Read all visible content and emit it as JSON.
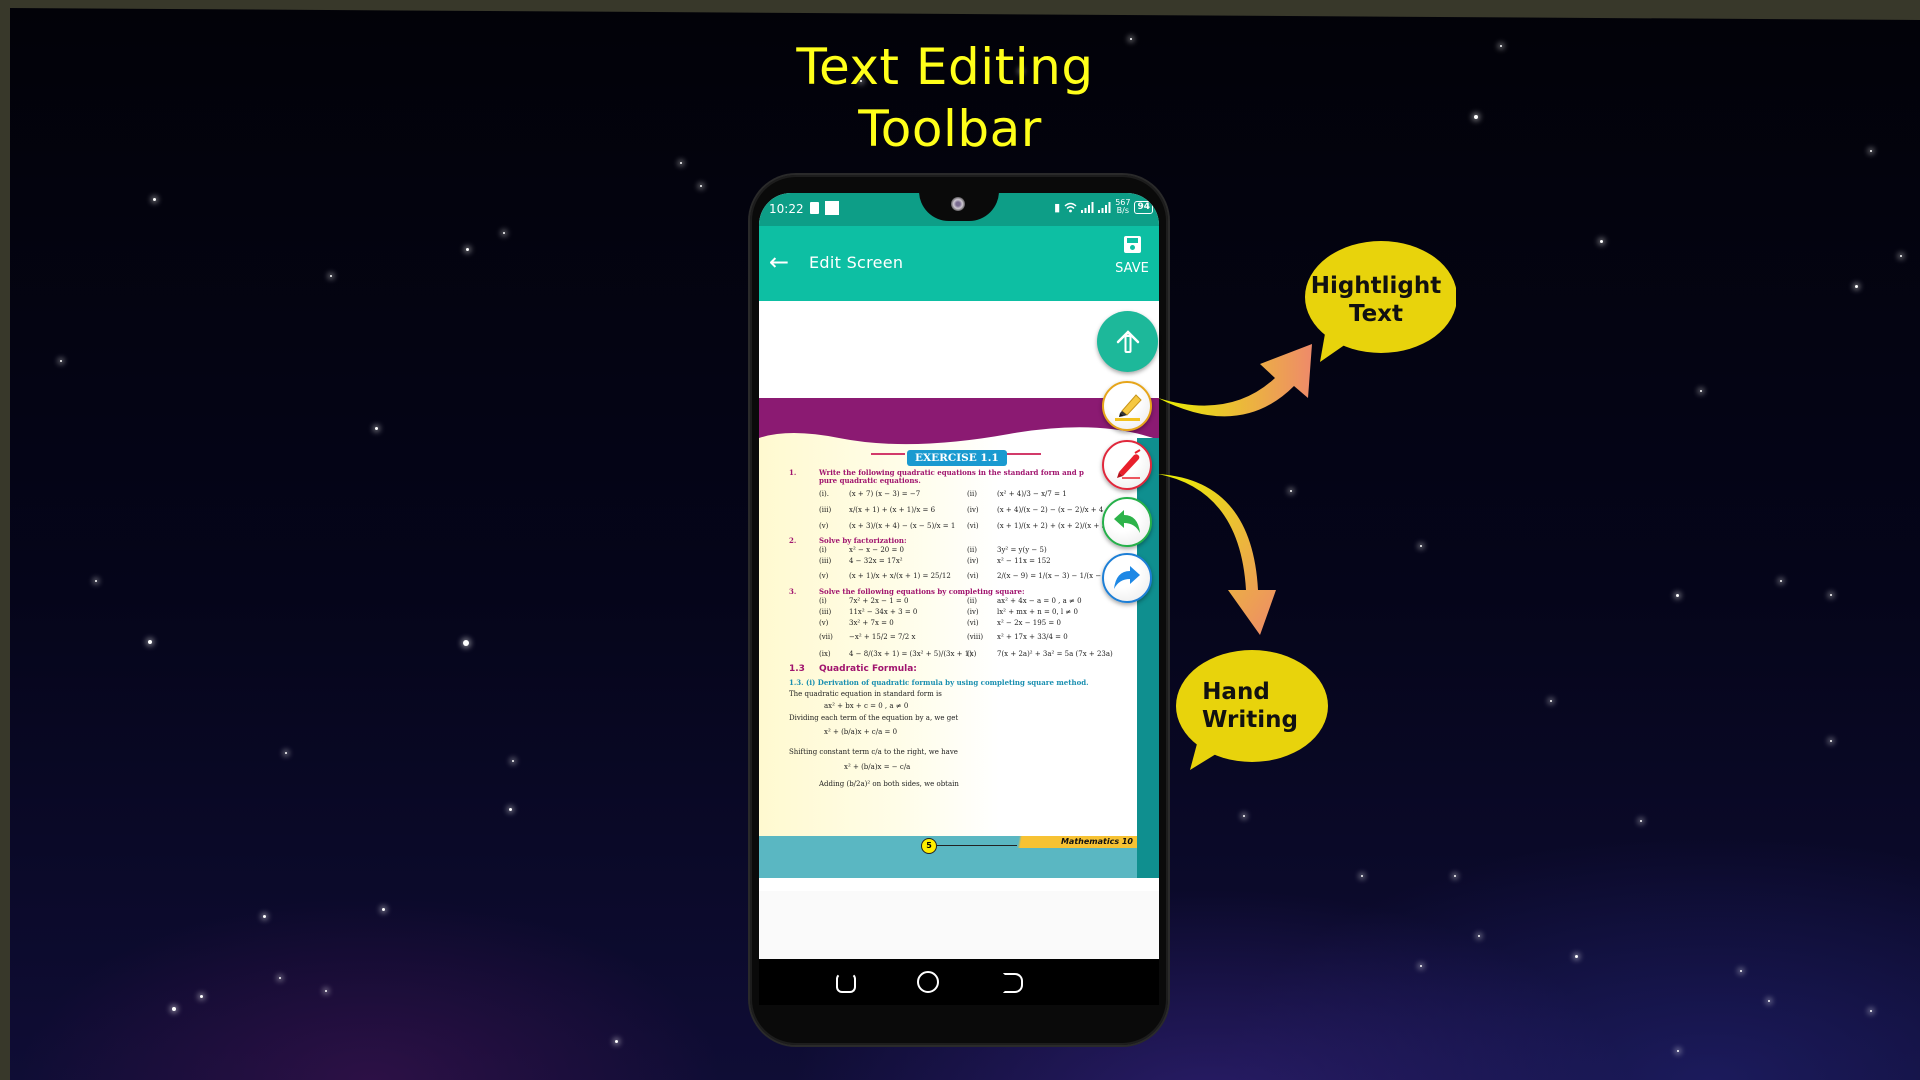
{
  "banner": {
    "title_line1": "Text Editing",
    "title_line2": "Toolbar"
  },
  "status_bar": {
    "time": "10:22",
    "net_speed_value": "567",
    "net_speed_unit": "B/s",
    "battery": "94",
    "icons": [
      "vibrate-icon",
      "wifi-icon",
      "signal-icon",
      "signal-icon"
    ]
  },
  "toolbar": {
    "back_icon": "arrow-left-icon",
    "title": "Edit Screen",
    "save_label": "SAVE",
    "save_icon": "floppy-disk-icon"
  },
  "fab_buttons": [
    {
      "name": "edit-tools-toggle",
      "icon": "pencil-upload-icon",
      "color": "#1db89a"
    },
    {
      "name": "highlight",
      "icon": "highlighter-icon",
      "color": "#e6a51a"
    },
    {
      "name": "handwriting",
      "icon": "pen-icon",
      "color": "#e0283c"
    },
    {
      "name": "undo",
      "icon": "undo-icon",
      "color": "#26b04a"
    },
    {
      "name": "redo",
      "icon": "redo-icon",
      "color": "#1d7fd6"
    }
  ],
  "document": {
    "exercise_title": "EXERCISE 1.1",
    "q1": {
      "num": "1.",
      "text": "Write the following quadratic equations in the standard form and p",
      "text2": "pure quadratic equations.",
      "items": [
        {
          "label": "(i).",
          "expr": "(x + 7) (x − 3) = −7"
        },
        {
          "label": "(ii)",
          "expr": "(x² + 4)/3 − x/7 = 1"
        },
        {
          "label": "(iii)",
          "expr": "x/(x + 1) + (x + 1)/x = 6"
        },
        {
          "label": "(iv)",
          "expr": "(x + 4)/(x − 2) − (x − 2)/x + 4 = 0"
        },
        {
          "label": "(v)",
          "expr": "(x + 3)/(x + 4) − (x − 5)/x = 1"
        },
        {
          "label": "(vi)",
          "expr": "(x + 1)/(x + 2) + (x + 2)/(x + 3) = 25/12"
        }
      ]
    },
    "q2": {
      "num": "2.",
      "text": "Solve by factorization:",
      "items": [
        {
          "label": "(i)",
          "expr": "x² − x − 20 = 0"
        },
        {
          "label": "(ii)",
          "expr": "3y² = y(y − 5)"
        },
        {
          "label": "(iii)",
          "expr": "4 − 32x = 17x²"
        },
        {
          "label": "(iv)",
          "expr": "x² − 11x = 152"
        },
        {
          "label": "(v)",
          "expr": "(x + 1)/x + x/(x + 1) = 25/12"
        },
        {
          "label": "(vi)",
          "expr": "2/(x − 9) = 1/(x − 3) − 1/(x − 4)"
        }
      ]
    },
    "q3": {
      "num": "3.",
      "text": "Solve the following equations by completing square:",
      "items": [
        {
          "label": "(i)",
          "expr": "7x² + 2x − 1 = 0"
        },
        {
          "label": "(ii)",
          "expr": "ax² + 4x − a = 0 , a ≠ 0"
        },
        {
          "label": "(iii)",
          "expr": "11x² − 34x + 3 = 0"
        },
        {
          "label": "(iv)",
          "expr": "lx² + mx + n = 0, l ≠ 0"
        },
        {
          "label": "(v)",
          "expr": "3x² + 7x = 0"
        },
        {
          "label": "(vi)",
          "expr": "x² − 2x − 195 = 0"
        },
        {
          "label": "(vii)",
          "expr": "−x² + 15/2 = 7/2 x"
        },
        {
          "label": "(viii)",
          "expr": "x² + 17x + 33/4 = 0"
        },
        {
          "label": "(ix)",
          "expr": "4 − 8/(3x + 1) = (3x² + 5)/(3x + 1)"
        },
        {
          "label": "(x)",
          "expr": "7(x + 2a)² + 3a² = 5a (7x + 23a)"
        }
      ]
    },
    "section_num": "1.3",
    "section_title": "Quadratic Formula:",
    "subsection": "1.3. (i) Derivation of quadratic formula by using completing square method.",
    "body": [
      "The quadratic equation in standard form is",
      "ax² + bx + c = 0  ,  a ≠ 0",
      "Dividing each term of the equation by a, we get",
      "x² + (b/a)x + c/a = 0",
      "Shifting constant term c/a to the right, we have",
      "x² + (b/a)x = − c/a",
      "Adding (b/2a)² on both sides, we obtain"
    ],
    "page_number": "5",
    "book_title": "Mathematics 10"
  },
  "callouts": {
    "highlight": {
      "line1": "Hightlight",
      "line2": "Text"
    },
    "handwriting": {
      "line1": "Hand",
      "line2": "Writing"
    }
  },
  "nav_bar": [
    "recent-apps-icon",
    "home-icon",
    "back-icon"
  ],
  "colors": {
    "accent_teal": "#0dbfa3",
    "status_teal": "#0d9e87",
    "title_yellow": "#ffff1a",
    "bubble_yellow": "#e8d30c"
  }
}
